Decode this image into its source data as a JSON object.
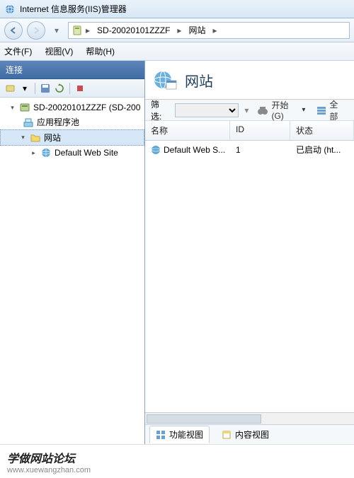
{
  "window": {
    "title": "Internet 信息服务(IIS)管理器"
  },
  "breadcrumb": {
    "items": [
      "SD-20020101ZZZF",
      "网站"
    ]
  },
  "menu": {
    "file": "文件(F)",
    "view": "视图(V)",
    "help": "帮助(H)"
  },
  "sidebar": {
    "title": "连接",
    "tree": {
      "server": "SD-20020101ZZZF (SD-200",
      "appPools": "应用程序池",
      "sites": "网站",
      "defaultSite": "Default Web Site"
    }
  },
  "content": {
    "title": "网站",
    "filter": {
      "label": "筛选:",
      "go": "开始(G)",
      "showAll": "全部"
    },
    "columns": {
      "name": "名称",
      "id": "ID",
      "status": "状态"
    },
    "rows": [
      {
        "name": "Default Web S...",
        "id": "1",
        "status": "已启动 (ht..."
      }
    ]
  },
  "viewtabs": {
    "features": "功能视图",
    "content": "内容视图"
  },
  "footer": {
    "brand": "学做网站论坛",
    "url": "www.xuewangzhan.com"
  }
}
